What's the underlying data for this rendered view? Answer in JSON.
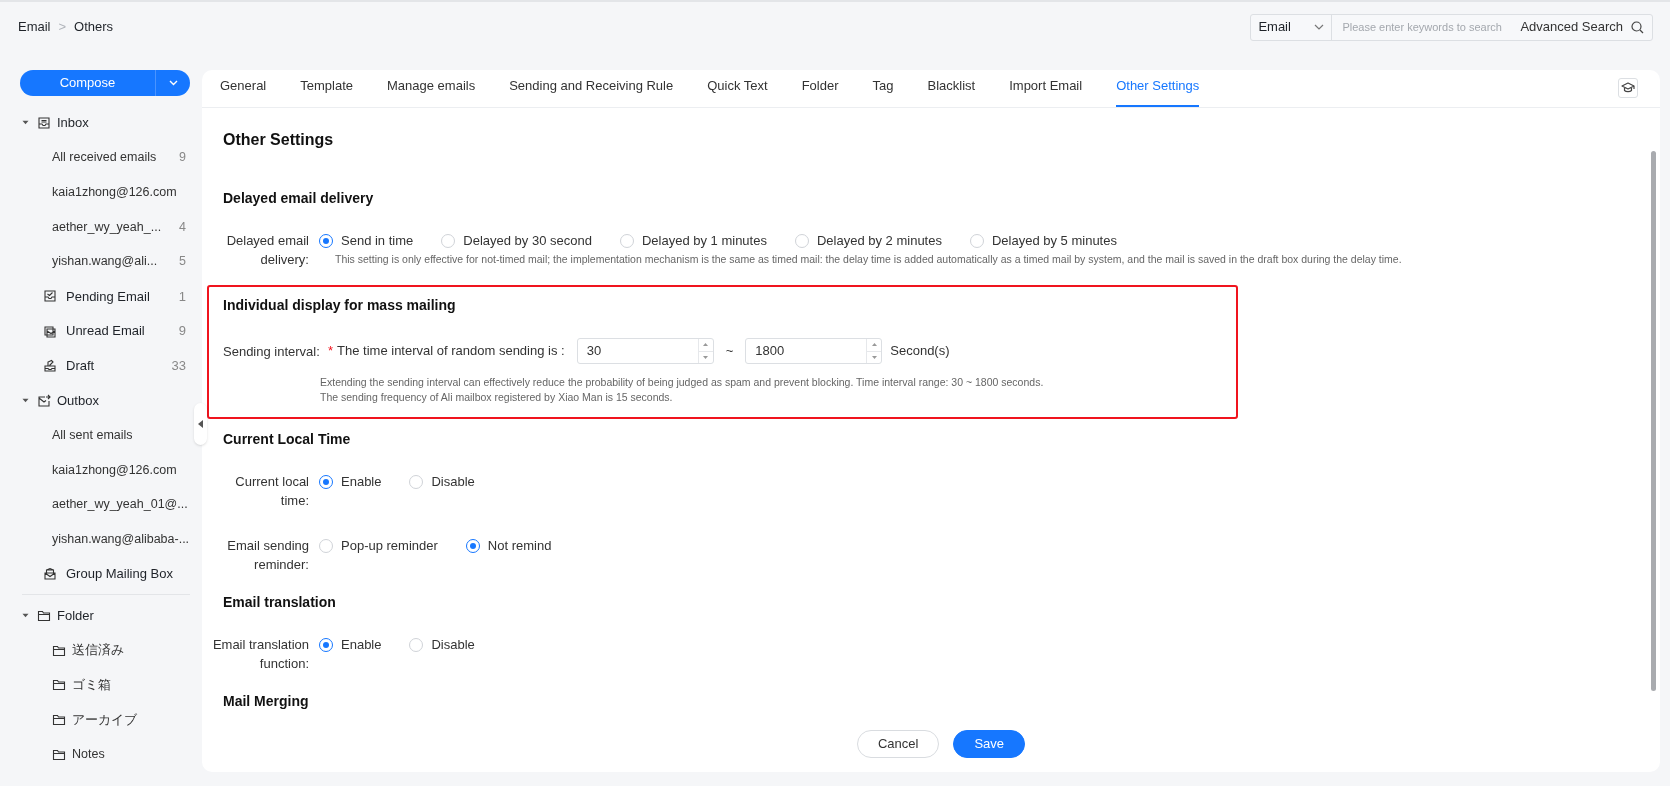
{
  "breadcrumb": {
    "items": [
      "Email",
      "Others"
    ],
    "separator": ">"
  },
  "search": {
    "scope": "Email",
    "placeholder": "Please enter keywords to search",
    "advanced": "Advanced Search"
  },
  "compose": {
    "label": "Compose"
  },
  "sidebar": {
    "mailboxes": [
      {
        "kind": "inbox",
        "label": "Inbox",
        "expanded": true,
        "children": [
          {
            "label": "All received emails",
            "count": "9"
          },
          {
            "label": "kaia1zhong@126.com"
          },
          {
            "label": "aether_wy_yeah_...",
            "count": "4"
          },
          {
            "label": "yishan.wang@ali...",
            "count": "5"
          }
        ]
      },
      {
        "kind": "pending",
        "label": "Pending Email",
        "count": "1"
      },
      {
        "kind": "unread",
        "label": "Unread Email",
        "count": "9"
      },
      {
        "kind": "draft",
        "label": "Draft",
        "count": "33"
      },
      {
        "kind": "outbox",
        "label": "Outbox",
        "expanded": true,
        "children": [
          {
            "label": "All sent emails"
          },
          {
            "label": "kaia1zhong@126.com"
          },
          {
            "label": "aether_wy_yeah_01@..."
          },
          {
            "label": "yishan.wang@alibaba-..."
          }
        ]
      },
      {
        "kind": "group",
        "label": "Group Mailing Box"
      }
    ],
    "folders": [
      {
        "kind": "folder",
        "label": "Folder",
        "expanded": true,
        "children": [
          {
            "kind": "folder",
            "label": "送信済み"
          },
          {
            "kind": "folder",
            "label": "ゴミ箱"
          },
          {
            "kind": "folder",
            "label": "アーカイブ"
          },
          {
            "kind": "folder",
            "label": "Notes"
          }
        ]
      }
    ]
  },
  "tabs": [
    {
      "label": "General",
      "selected": false
    },
    {
      "label": "Template",
      "selected": false
    },
    {
      "label": "Manage emails",
      "selected": false
    },
    {
      "label": "Sending and Receiving Rule",
      "selected": false
    },
    {
      "label": "Quick Text",
      "selected": false
    },
    {
      "label": "Folder",
      "selected": false
    },
    {
      "label": "Tag",
      "selected": false
    },
    {
      "label": "Blacklist",
      "selected": false
    },
    {
      "label": "Import Email",
      "selected": false
    },
    {
      "label": "Other Settings",
      "selected": true
    }
  ],
  "content": {
    "title": "Other Settings",
    "sections": [
      {
        "title": "Delayed email delivery",
        "highlighted": false,
        "fields": [
          {
            "kind": "radio",
            "label": "Delayed email delivery:",
            "options": [
              {
                "label": "Send in time",
                "selected": true
              },
              {
                "label": "Delayed by 30 second",
                "selected": false
              },
              {
                "label": "Delayed by 1 minutes",
                "selected": false
              },
              {
                "label": "Delayed by 2 minutes",
                "selected": false
              },
              {
                "label": "Delayed by 5 minutes",
                "selected": false
              }
            ],
            "hints": [
              "This setting is only effective for not-timed mail; the implementation mechanism is the same as timed mail: the delay time is added automatically as a timed mail by system, and the mail is saved in the draft box during the delay time."
            ]
          }
        ]
      },
      {
        "title": "Individual display for mass mailing",
        "highlighted": true,
        "fields": [
          {
            "kind": "interval",
            "label": "Sending interval:",
            "required_mark": "*",
            "prompt": "The time interval of random sending is :",
            "min": "30",
            "separator": "~",
            "max": "1800",
            "unit": "Second(s)",
            "hints": [
              "Extending the sending interval can effectively reduce the probability of being judged as spam and prevent blocking. Time interval range: 30 ~ 1800 seconds.",
              "The sending frequency of Ali mailbox registered by Xiao Man is 15 seconds."
            ]
          }
        ]
      },
      {
        "title": "Current Local Time",
        "highlighted": false,
        "fields": [
          {
            "kind": "radio",
            "label": "Current local time:",
            "options": [
              {
                "label": "Enable",
                "selected": true
              },
              {
                "label": "Disable",
                "selected": false
              }
            ]
          },
          {
            "kind": "radio",
            "label": "Email sending reminder:",
            "options": [
              {
                "label": "Pop-up reminder",
                "selected": false
              },
              {
                "label": "Not remind",
                "selected": true
              }
            ]
          }
        ]
      },
      {
        "title": "Email translation",
        "highlighted": false,
        "fields": [
          {
            "kind": "radio",
            "label": "Email translation function:",
            "options": [
              {
                "label": "Enable",
                "selected": true
              },
              {
                "label": "Disable",
                "selected": false
              }
            ]
          }
        ]
      },
      {
        "title": "Mail Merging",
        "highlighted": false
      }
    ]
  },
  "buttons": [
    {
      "label": "Cancel",
      "kind": "secondary"
    },
    {
      "label": "Save",
      "kind": "primary"
    }
  ]
}
